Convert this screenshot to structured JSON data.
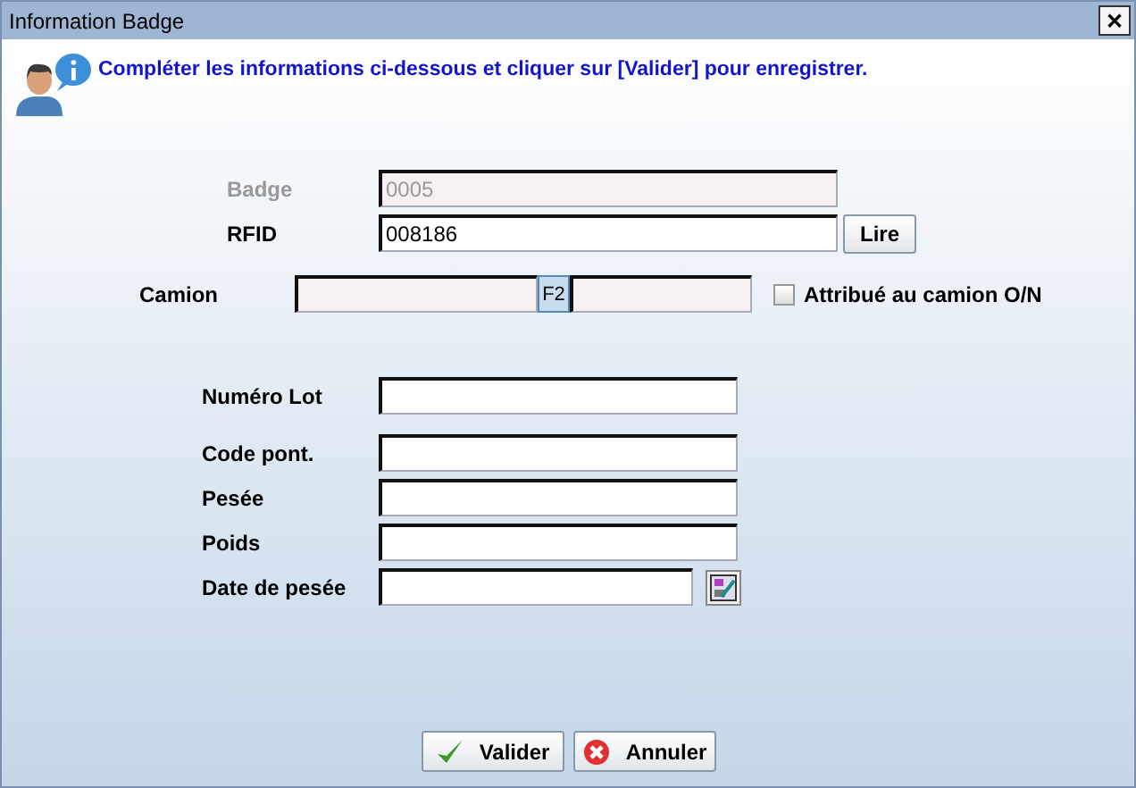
{
  "window": {
    "title": "Information Badge",
    "close": "✕"
  },
  "message": "Compléter les informations ci-dessous et cliquer sur [Valider] pour enregistrer.",
  "badge": {
    "label": "Badge",
    "value": "0005",
    "disabled": true
  },
  "rfid": {
    "label": "RFID",
    "value": "008186",
    "disabled": false,
    "button": "Lire"
  },
  "camion": {
    "label": "Camion",
    "disabled": true,
    "button": "F2",
    "checkbox": {
      "label": "Attribué au camion O/N",
      "checked": false
    }
  },
  "fields": [
    {
      "label": "Numéro Lot",
      "kind": "text"
    },
    {
      "label": "Code pont.",
      "kind": "text"
    },
    {
      "label": "Pesée",
      "kind": "text"
    },
    {
      "label": "Poids",
      "kind": "text"
    },
    {
      "label": "Date de pesée",
      "kind": "date"
    }
  ],
  "buttons": [
    {
      "label": "Valider",
      "kind": "ok"
    },
    {
      "label": "Annuler",
      "kind": "cancel"
    }
  ]
}
